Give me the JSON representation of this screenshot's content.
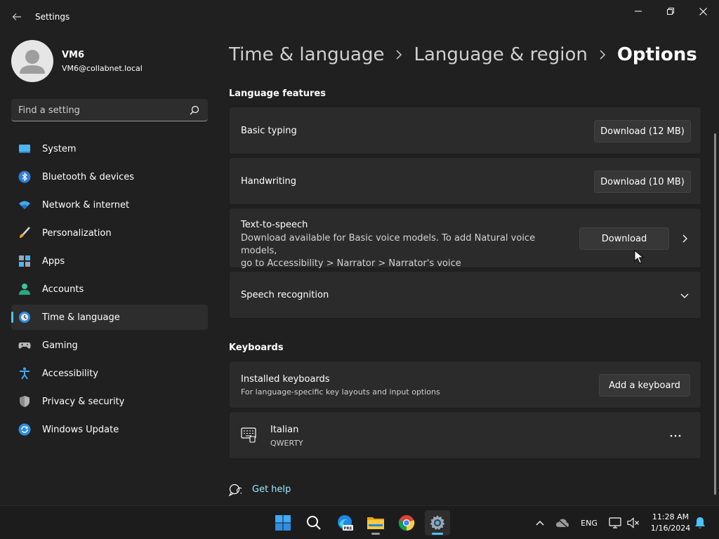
{
  "window": {
    "title": "Settings"
  },
  "profile": {
    "name": "VM6",
    "email": "VM6@collabnet.local"
  },
  "search": {
    "placeholder": "Find a setting"
  },
  "sidebar": {
    "items": [
      {
        "label": "System",
        "icon": "system-icon",
        "active": false
      },
      {
        "label": "Bluetooth & devices",
        "icon": "bluetooth-icon",
        "active": false
      },
      {
        "label": "Network & internet",
        "icon": "wifi-icon",
        "active": false
      },
      {
        "label": "Personalization",
        "icon": "brush-icon",
        "active": false
      },
      {
        "label": "Apps",
        "icon": "apps-icon",
        "active": false
      },
      {
        "label": "Accounts",
        "icon": "accounts-icon",
        "active": false
      },
      {
        "label": "Time & language",
        "icon": "time-language-icon",
        "active": true
      },
      {
        "label": "Gaming",
        "icon": "gamepad-icon",
        "active": false
      },
      {
        "label": "Accessibility",
        "icon": "accessibility-icon",
        "active": false
      },
      {
        "label": "Privacy & security",
        "icon": "shield-icon",
        "active": false
      },
      {
        "label": "Windows Update",
        "icon": "update-icon",
        "active": false
      }
    ]
  },
  "breadcrumb": {
    "items": [
      "Time & language",
      "Language & region",
      "Options"
    ]
  },
  "language_features": {
    "heading": "Language features",
    "basic_typing": {
      "title": "Basic typing",
      "button": "Download (12 MB)"
    },
    "handwriting": {
      "title": "Handwriting",
      "button": "Download (10 MB)"
    },
    "tts": {
      "title": "Text-to-speech",
      "desc_line1": "Download available for Basic voice models. To add Natural voice models,",
      "desc_line2": "go to Accessibility > Narrator > Narrator's voice",
      "button": "Download"
    },
    "speech": {
      "title": "Speech recognition"
    }
  },
  "keyboards": {
    "heading": "Keyboards",
    "installed": {
      "title": "Installed keyboards",
      "subtitle": "For language-specific key layouts and input options",
      "button": "Add a keyboard"
    },
    "items": [
      {
        "name": "Italian",
        "layout": "QWERTY"
      }
    ]
  },
  "help": {
    "label": "Get help"
  },
  "taskbar": {
    "language": "ENG",
    "time": "11:28 AM",
    "date": "1/16/2024"
  },
  "colors": {
    "background": "#202020",
    "card": "#2b2b2b",
    "accent": "#4cc2ff",
    "link": "#99ebff"
  }
}
